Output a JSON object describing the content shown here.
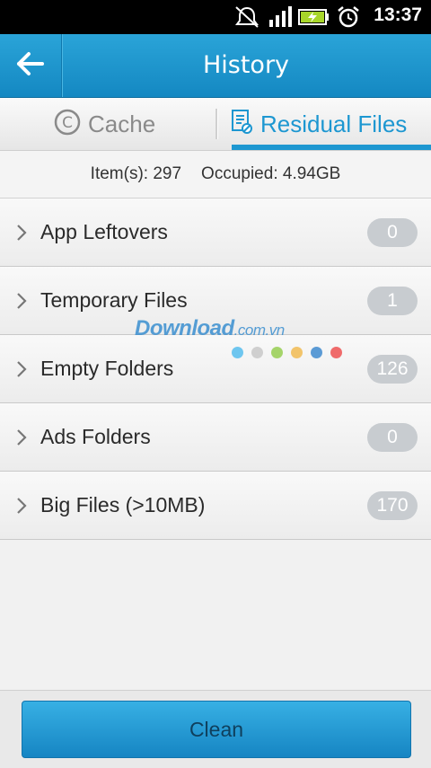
{
  "status_bar": {
    "time": "13:37",
    "icons": [
      "alarm-muted-icon",
      "signal-icon",
      "battery-charging-icon",
      "alarm-clock-icon"
    ]
  },
  "header": {
    "title": "History",
    "back_icon": "arrow-left-icon"
  },
  "tabs": [
    {
      "label": "Cache",
      "icon": "copyright-circle-icon",
      "active": false
    },
    {
      "label": "Residual Files",
      "icon": "document-icon",
      "active": true
    }
  ],
  "summary": {
    "items": "Item(s): 297",
    "occupied": "Occupied: 4.94GB"
  },
  "list": [
    {
      "label": "App Leftovers",
      "count": "0"
    },
    {
      "label": "Temporary Files",
      "count": "1"
    },
    {
      "label": "Empty Folders",
      "count": "126"
    },
    {
      "label": "Ads Folders",
      "count": "0"
    },
    {
      "label": "Big Files (>10MB)",
      "count": "170"
    }
  ],
  "watermark": {
    "brand": "Download",
    "domain": ".com.vn",
    "dot_colors": [
      "#6ec6ef",
      "#cfcfcf",
      "#a5d46a",
      "#f2c46b",
      "#5b9bd5",
      "#ef6b6b"
    ]
  },
  "footer": {
    "clean_label": "Clean"
  },
  "colors": {
    "accent": "#1d97d1",
    "header": "#1a93cc",
    "badge": "#c8ccd0"
  }
}
